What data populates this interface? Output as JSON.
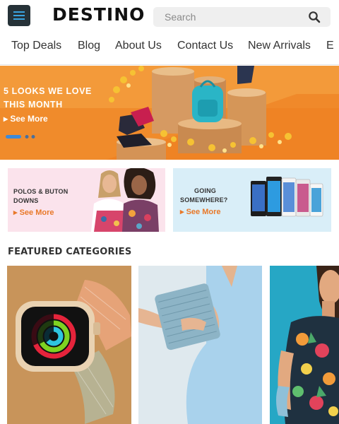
{
  "header": {
    "logo": "DESTINO",
    "menu_icon": "hamburger-menu-icon",
    "search": {
      "placeholder": "Search",
      "icon": "search-icon"
    }
  },
  "nav": {
    "items": [
      "Top Deals",
      "Blog",
      "About Us",
      "Contact Us",
      "New Arrivals",
      "E"
    ]
  },
  "hero": {
    "title_line1": "5 LOOKS WE LOVE",
    "title_line2": "THIS MONTH",
    "link": "See More",
    "carousel": {
      "slides": 3,
      "active": 1
    }
  },
  "promos": [
    {
      "title_line1": "POLOS & BUTON",
      "title_line2": "DOWNS",
      "link": "See More"
    },
    {
      "title_line1": "GOING",
      "title_line2": "SOMEWHERE?",
      "link": "See More"
    }
  ],
  "featured": {
    "title": "FEATURED CATEGORIES"
  },
  "colors": {
    "accent_orange": "#e8792a",
    "hero_bg": "#f28a2a",
    "menu_button": "#263238",
    "menu_lines": "#39a3e0",
    "dot_active": "#3d8ad8"
  }
}
